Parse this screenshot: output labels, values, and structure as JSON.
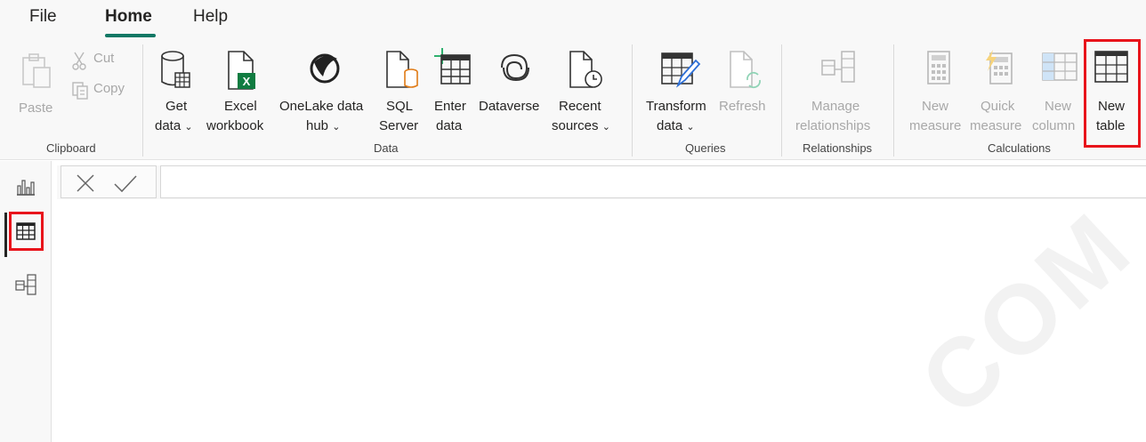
{
  "tabs": [
    "File",
    "Home",
    "Help"
  ],
  "clipboard": {
    "paste": "Paste",
    "cut": "Cut",
    "copy": "Copy",
    "group": "Clipboard"
  },
  "data": {
    "get_data": [
      "Get",
      "data"
    ],
    "excel": [
      "Excel",
      "workbook"
    ],
    "onelake": [
      "OneLake data",
      "hub"
    ],
    "sql": [
      "SQL",
      "Server"
    ],
    "enter": [
      "Enter",
      "data"
    ],
    "dataverse": "Dataverse",
    "recent": [
      "Recent",
      "sources"
    ],
    "group": "Data"
  },
  "queries": {
    "transform": [
      "Transform",
      "data"
    ],
    "refresh": "Refresh",
    "group": "Queries"
  },
  "relationships": {
    "manage": [
      "Manage",
      "relationships"
    ],
    "group": "Relationships"
  },
  "calculations": {
    "new_measure": [
      "New",
      "measure"
    ],
    "quick_measure": [
      "Quick",
      "measure"
    ],
    "new_column": [
      "New",
      "column"
    ],
    "new_table": [
      "New",
      "table"
    ],
    "group": "Calculations"
  },
  "watermark": "COM",
  "colors": {
    "accent": "#117865",
    "highlight": "#e8141b",
    "excel_green": "#107c41"
  }
}
